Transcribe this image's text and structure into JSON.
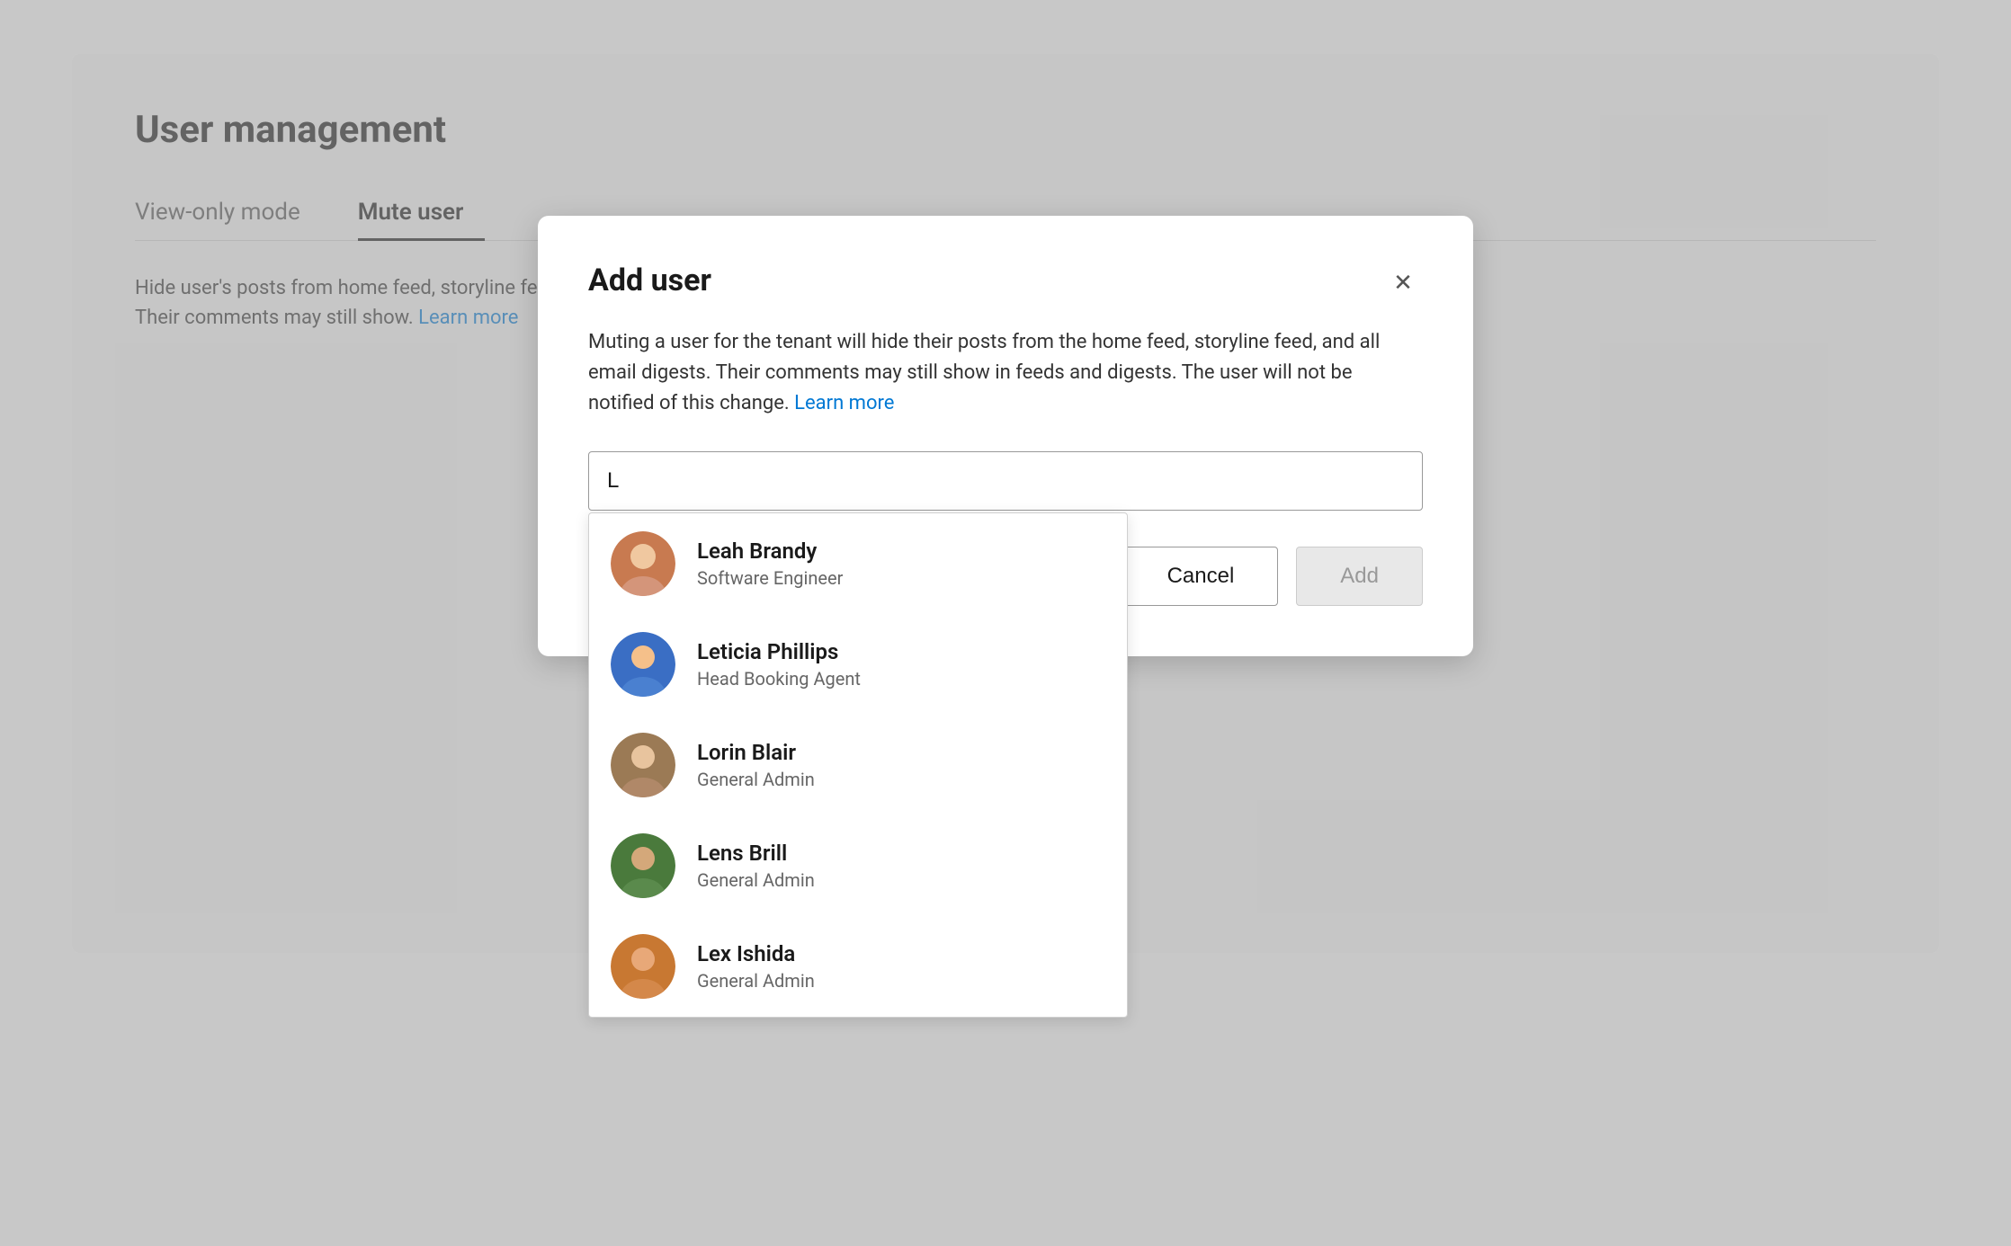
{
  "page": {
    "title": "User management",
    "tabs": [
      {
        "label": "View-only mode",
        "active": false
      },
      {
        "label": "Mute user",
        "active": true
      }
    ],
    "description": {
      "text": "Hide user's posts from home feed, storyline feed, and all email digests.\nTheir comments may still show.",
      "link_text": "Learn more"
    }
  },
  "modal": {
    "title": "Add user",
    "description": "Muting a user for the tenant will hide their posts from the home feed, storyline feed, and all email digests. Their comments may still show in feeds and digests. The user will not be notified of this change.",
    "link_text": "Learn more",
    "search": {
      "value": "L",
      "placeholder": ""
    },
    "buttons": {
      "cancel": "Cancel",
      "add": "Add"
    },
    "dropdown": {
      "users": [
        {
          "name": "Leah Brandy",
          "role": "Software Engineer",
          "avatar_color": "leah"
        },
        {
          "name": "Leticia Phillips",
          "role": "Head Booking Agent",
          "avatar_color": "leticia"
        },
        {
          "name": "Lorin Blair",
          "role": "General Admin",
          "avatar_color": "lorin"
        },
        {
          "name": "Lens Brill",
          "role": "General Admin",
          "avatar_color": "lens"
        },
        {
          "name": "Lex Ishida",
          "role": "General Admin",
          "avatar_color": "lex"
        }
      ]
    }
  },
  "colors": {
    "accent_blue": "#0078d4"
  }
}
